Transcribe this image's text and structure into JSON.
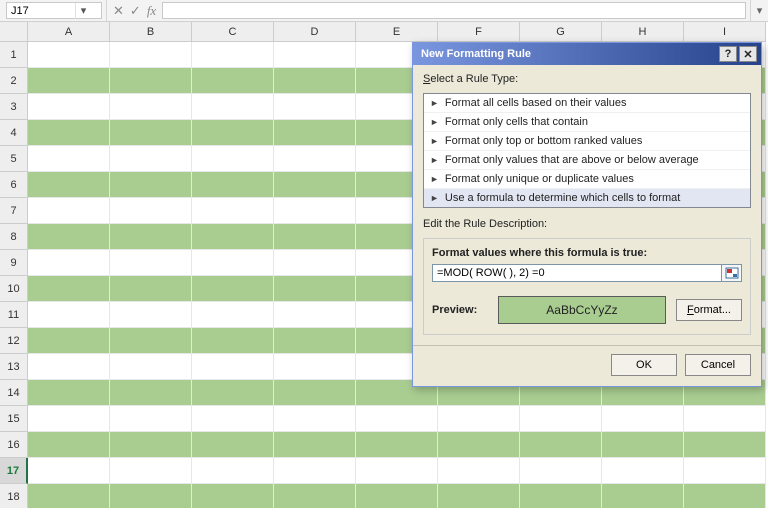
{
  "namebox": {
    "value": "J17"
  },
  "formula_bar": {
    "value": ""
  },
  "columns": [
    "A",
    "B",
    "C",
    "D",
    "E",
    "F",
    "G",
    "H",
    "I"
  ],
  "rows": [
    "1",
    "2",
    "3",
    "4",
    "5",
    "6",
    "7",
    "8",
    "9",
    "10",
    "11",
    "12",
    "13",
    "14",
    "15",
    "16",
    "17",
    "18"
  ],
  "active_row_index": 16,
  "band_color": "#a9cd91",
  "dialog": {
    "title": "New Formatting Rule",
    "select_label": "Select a Rule Type:",
    "rule_types": [
      "Format all cells based on their values",
      "Format only cells that contain",
      "Format only top or bottom ranked values",
      "Format only values that are above or below average",
      "Format only unique or duplicate values",
      "Use a formula to determine which cells to format"
    ],
    "selected_rule_index": 5,
    "edit_label": "Edit the Rule Description:",
    "formula_label": "Format values where this formula is true:",
    "formula_value": "=MOD( ROW( ), 2) =0",
    "preview_label": "Preview:",
    "preview_sample": "AaBbCcYyZz",
    "format_button": "Format...",
    "ok": "OK",
    "cancel": "Cancel"
  }
}
